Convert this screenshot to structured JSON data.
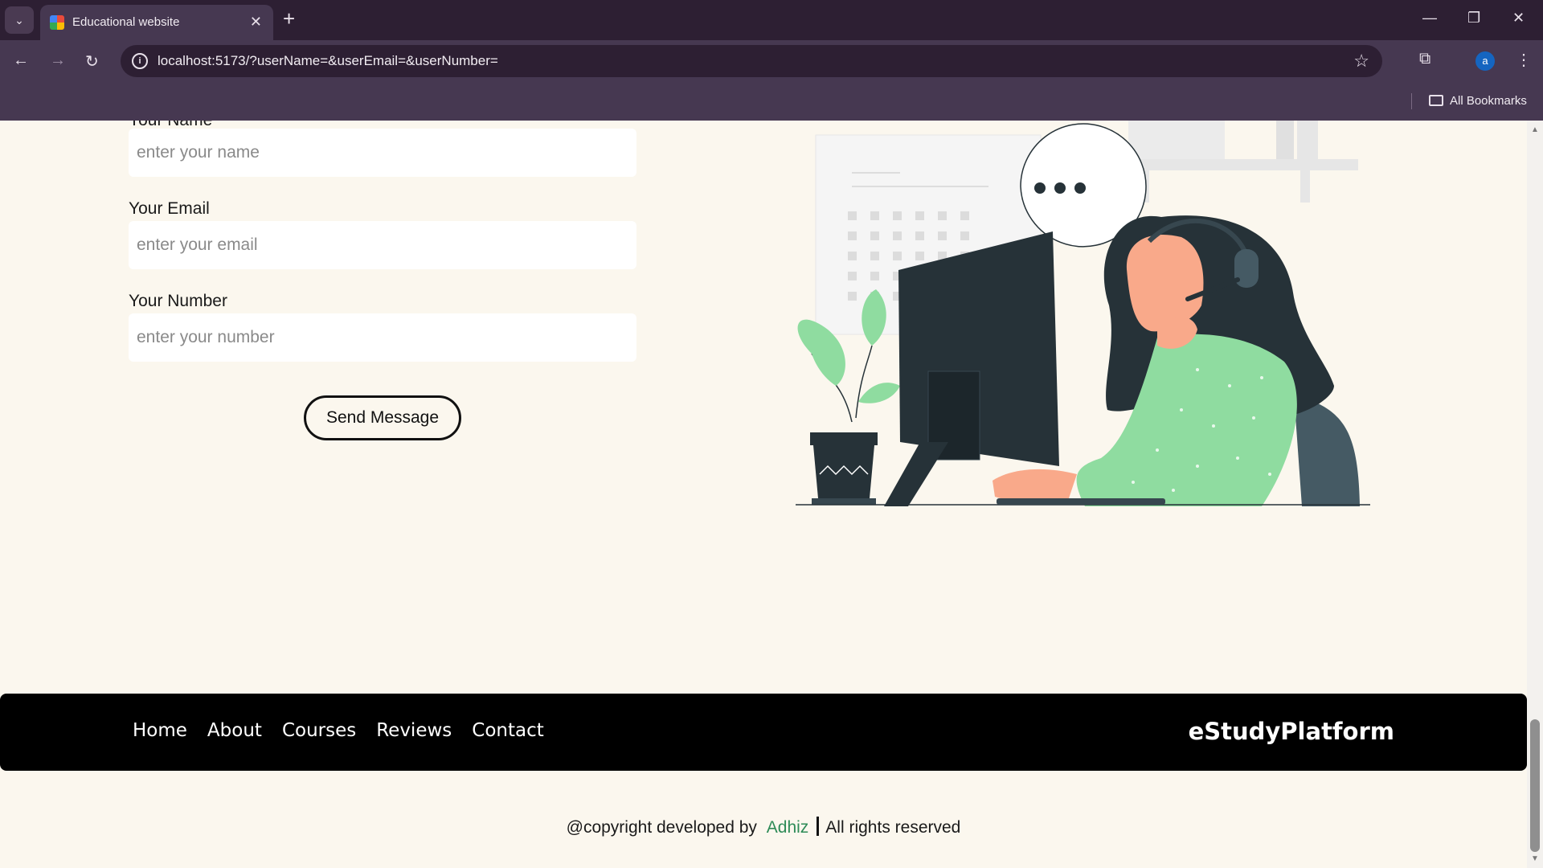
{
  "browser": {
    "tab_title": "Educational website",
    "url": "localhost:5173/?userName=&userEmail=&userNumber=",
    "bookmarks_label": "All Bookmarks",
    "profile_initial": "a"
  },
  "form": {
    "partial_label": "Your Name",
    "name_placeholder": "enter your name",
    "email_label": "Your Email",
    "email_placeholder": "enter your email",
    "number_label": "Your Number",
    "number_placeholder": "enter your number",
    "send_label": "Send Message"
  },
  "footer": {
    "nav": [
      "Home",
      "About",
      "Courses",
      "Reviews",
      "Contact"
    ],
    "brand": "eStudyPlatform"
  },
  "copyright": {
    "prefix": "@copyright developed by",
    "author": "Adhiz",
    "suffix": "All rights reserved"
  },
  "colors": {
    "page_bg": "#fbf7ee",
    "footer_bg": "#000000",
    "author_link": "#2e8b57",
    "illustration_green": "#8fdca0",
    "illustration_dark": "#263238"
  }
}
